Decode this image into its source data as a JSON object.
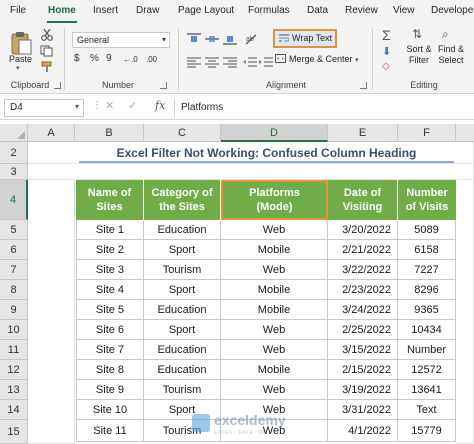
{
  "ribbon": {
    "tabs": [
      "File",
      "Home",
      "Insert",
      "Draw",
      "Page Layout",
      "Formulas",
      "Data",
      "Review",
      "View",
      "Developer"
    ],
    "active_tab": "Home",
    "groups": {
      "clipboard": "Clipboard",
      "number": "Number",
      "alignment": "Alignment",
      "editing": "Editing"
    },
    "paste_label": "Paste",
    "number_format": "General",
    "number_buttons": [
      "$",
      "%",
      "9",
      "←.0",
      ".00"
    ],
    "wrap_text": "Wrap Text",
    "merge_center": "Merge & Center",
    "sort_filter": [
      "Sort &",
      "Filter"
    ],
    "find_select": [
      "Find &",
      "Select"
    ],
    "accent_color": "#217346",
    "highlight_color": "#e69138"
  },
  "formula_bar": {
    "name_box": "D4",
    "fx": "fx",
    "formula": "Platforms"
  },
  "sheet": {
    "columns": [
      "A",
      "B",
      "C",
      "D",
      "E",
      "F"
    ],
    "rows": [
      "1",
      "2",
      "3",
      "4",
      "5",
      "6",
      "7",
      "8",
      "9",
      "10",
      "11",
      "12",
      "13",
      "14",
      "15"
    ],
    "selected_column": "D",
    "selected_row": "4",
    "title": "Excel Filter Not Working: Confused Column Heading",
    "headers": [
      [
        "Name of",
        "Sites"
      ],
      [
        "Category of",
        "the Sites"
      ],
      [
        "Platforms",
        "(Mode)"
      ],
      [
        "Date of",
        "Visiting"
      ],
      [
        "Number",
        "of Visits"
      ]
    ],
    "table_rows": [
      [
        "Site 1",
        "Education",
        "Web",
        "3/20/2022",
        "5089"
      ],
      [
        "Site 2",
        "Sport",
        "Mobile",
        "2/21/2022",
        "6158"
      ],
      [
        "Site 3",
        "Tourism",
        "Web",
        "3/22/2022",
        "7227"
      ],
      [
        "Site 4",
        "Sport",
        "Mobile",
        "2/23/2022",
        "8296"
      ],
      [
        "Site 5",
        "Education",
        "Mobile",
        "3/24/2022",
        "9365"
      ],
      [
        "Site 6",
        "Sport",
        "Web",
        "2/25/2022",
        "10434"
      ],
      [
        "Site 7",
        "Education",
        "Web",
        "3/15/2022",
        "Number"
      ],
      [
        "Site 8",
        "Education",
        "Mobile",
        "2/15/2022",
        "12572"
      ],
      [
        "Site 9",
        "Tourism",
        "Web",
        "3/19/2022",
        "13641"
      ],
      [
        "Site 10",
        "Sport",
        "Web",
        "3/31/2022",
        "Text"
      ],
      [
        "Site 11",
        "Tourism",
        "Web",
        "4/1/2022",
        "15779"
      ]
    ],
    "header_color": "#70ad47"
  },
  "watermark": {
    "name": "exceldemy",
    "tagline": "EXCEL · DATA · BI"
  }
}
